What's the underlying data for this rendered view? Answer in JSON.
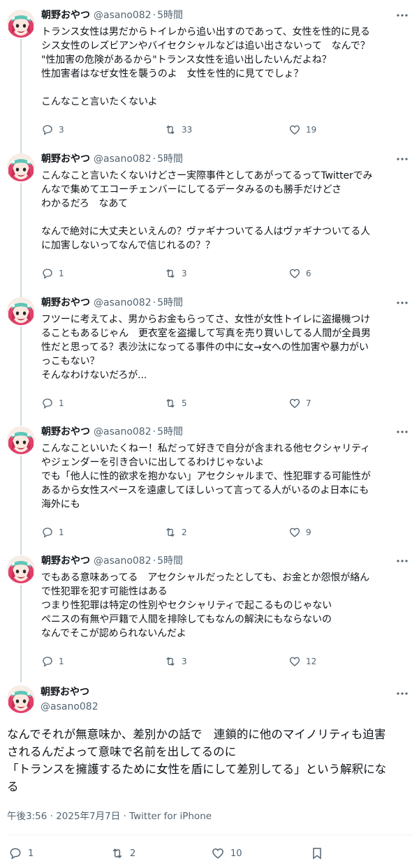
{
  "author": {
    "name": "朝野おやつ",
    "handle": "@asano082",
    "separator": "·"
  },
  "tweets": [
    {
      "time": "5時間",
      "text": "トランス女性は男だからトイレから追い出すのであって、女性を性的に見る\nシス女性のレズビアンやバイセクシャルなどは追い出さないって　なんで？\n\"性加害の危険があるから\"トランス女性を追い出したいんだよね？\n性加害者はなぜ女性を襲うのよ　女性を性的に見てでしょ？\n\nこんなこと言いたくないよ",
      "replies": "3",
      "retweets": "33",
      "likes": "19"
    },
    {
      "time": "5時間",
      "text": "こんなこと言いたくないけどさー実際事件としてあがってるってTwitterでみ\nんなで集めてエコーチェンバーにしてるデータみるのも勝手だけどさ\nわかるだろ　なあて\n\nなんで絶対に大丈夫といえんの？ヴァギナついてる人はヴァギナついてる人\nに加害しないってなんで信じれるの？？",
      "replies": "1",
      "retweets": "3",
      "likes": "6"
    },
    {
      "time": "5時間",
      "text": "フツーに考えてよ、男からお金もらってさ、女性が女性トイレに盗撮機つけ\nることもあるじゃん　更衣室を盗撮して写真を売り買いしてる人間が全員男\n性だと思ってる？表沙汰になってる事件の中に女→女への性加害や暴力がい\nっこもない？\nそんなわけないだろが...",
      "replies": "1",
      "retweets": "5",
      "likes": "7"
    },
    {
      "time": "5時間",
      "text": "こんなこといいたくねー！私だって好きで自分が含まれる他セクシャリティ\nやジェンダーを引き合いに出してるわけじゃないよ\nでも「他人に性的欲求を抱かない」アセクシャルまで、性犯罪する可能性が\nあるから女性スペースを遠慮してほしいって言ってる人がいるのよ日本にも\n海外にも",
      "replies": "1",
      "retweets": "2",
      "likes": "9"
    },
    {
      "time": "5時間",
      "text": "でもある意味あってる　アセクシャルだったとしても、お金とか怨恨が絡ん\nで性犯罪を犯す可能性はある\nつまり性犯罪は特定の性別やセクシャリティで起こるものじゃない\nペニスの有無や戸籍で人間を排除してもなんの解決にもならないの\nなんでそこが認められないんだよ",
      "replies": "1",
      "retweets": "3",
      "likes": "12"
    }
  ],
  "main": {
    "text": "なんでそれが無意味か、差別かの話で　連鎖的に他のマイノリティも迫害\nされるんだよって意味で名前を出してるのに\n「トランスを擁護するために女性を盾にして差別してる」という解釈にな\nる",
    "timestamp": "午後3:56 · 2025年7月7日 · Twitter for iPhone",
    "replies": "1",
    "retweets": "2",
    "likes": "10"
  },
  "icons": {
    "more": "more-dots-icon",
    "reply": "reply-bubble-icon",
    "retweet": "retweet-arrows-icon",
    "like": "heart-icon",
    "bookmark": "bookmark-icon"
  },
  "colors": {
    "text": "#0f1419",
    "secondary": "#536471",
    "thread_line": "#cfd9de",
    "avatar_hair": "#e23f6a",
    "avatar_headband": "#5fc6b8"
  }
}
